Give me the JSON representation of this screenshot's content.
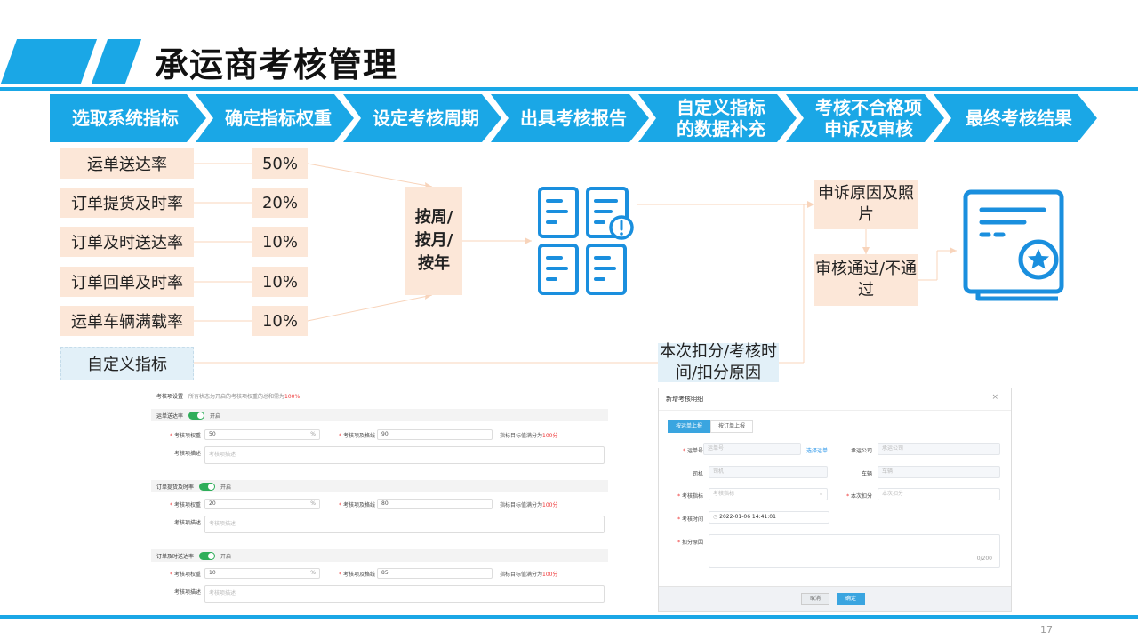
{
  "title": "承运商考核管理",
  "colors": {
    "accent": "#1aa7e6",
    "box_fill": "#fce7d8",
    "box_blue": "#e2f0f8"
  },
  "steps": [
    {
      "label": "选取系统指标"
    },
    {
      "label": "确定指标权重"
    },
    {
      "label": "设定考核周期"
    },
    {
      "label": "出具考核报告"
    },
    {
      "label": "自定义指标的数据补充"
    },
    {
      "label": "考核不合格项申诉及审核"
    },
    {
      "label": "最终考核结果"
    }
  ],
  "indicators": [
    {
      "name": "运单送达率",
      "weight": "50%"
    },
    {
      "name": "订单提货及时率",
      "weight": "20%"
    },
    {
      "name": "订单及时送达率",
      "weight": "10%"
    },
    {
      "name": "订单回单及时率",
      "weight": "10%"
    },
    {
      "name": "运单车辆满载率",
      "weight": "10%"
    }
  ],
  "custom_indicator": "自定义指标",
  "period": [
    "按周/",
    "按月/",
    "按年"
  ],
  "icons": {
    "report": "report-documents-icon",
    "result": "certificate-star-icon"
  },
  "appeal": "申诉原因及照片",
  "review": "审核通过/不通过",
  "deduction": "本次扣分/考核时间/扣分原因",
  "left_panel": {
    "header_label": "考核项设置",
    "header_hint_prefix": "所有状态为开启的考核项权重的总和需为",
    "header_hint_value": "100%",
    "sections": [
      {
        "name": "运单送达率",
        "toggle": "开启",
        "weight": "50",
        "baseline": "90"
      },
      {
        "name": "订单提货及时率",
        "toggle": "开启",
        "weight": "20",
        "baseline": "80"
      },
      {
        "name": "订单及时送达率",
        "toggle": "开启",
        "weight": "10",
        "baseline": "85"
      }
    ],
    "weight_label": "考核项权重",
    "baseline_label": "考核项及格线",
    "unit": "%",
    "score_note_prefix": "指标目标值满分为",
    "score_note_value": "100分",
    "desc_label": "考核项描述",
    "desc_placeholder": "考核项描述"
  },
  "right_panel": {
    "title": "新增考核明细",
    "close": "×",
    "tabs": [
      "按运单上报",
      "按订单上报"
    ],
    "waybill_label": "运单号",
    "waybill_placeholder": "运单号",
    "select_link": "选择运单",
    "carrier_label": "承运公司",
    "carrier_placeholder": "承运公司",
    "driver_label": "司机",
    "driver_placeholder": "司机",
    "vehicle_label": "车辆",
    "vehicle_placeholder": "车辆",
    "indicator_label": "考核指标",
    "indicator_placeholder": "考核指标",
    "deduct_label": "本次扣分",
    "deduct_placeholder": "本次扣分",
    "time_label": "考核时间",
    "time_value": "2022-01-06 14:41:01",
    "reason_label": "扣分原因",
    "reason_counter": "0/200",
    "cancel": "取消",
    "confirm": "确定"
  },
  "page_number": "17"
}
